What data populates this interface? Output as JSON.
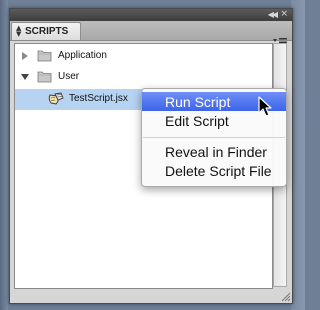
{
  "panel": {
    "tab_label": "SCRIPTS"
  },
  "tree": {
    "items": [
      {
        "label": "Application",
        "type": "folder",
        "expanded": false
      },
      {
        "label": "User",
        "type": "folder",
        "expanded": true
      },
      {
        "label": "TestScript.jsx",
        "type": "script",
        "selected": true
      }
    ]
  },
  "context_menu": {
    "items": [
      {
        "label": "Run Script",
        "highlighted": true
      },
      {
        "label": "Edit Script"
      },
      {
        "label": "Reveal in Finder"
      },
      {
        "label": "Delete Script File"
      }
    ]
  },
  "colors": {
    "selection": "#b6d3f2",
    "menu_highlight": "#3d63e8",
    "desktop": "#6e7f96"
  }
}
